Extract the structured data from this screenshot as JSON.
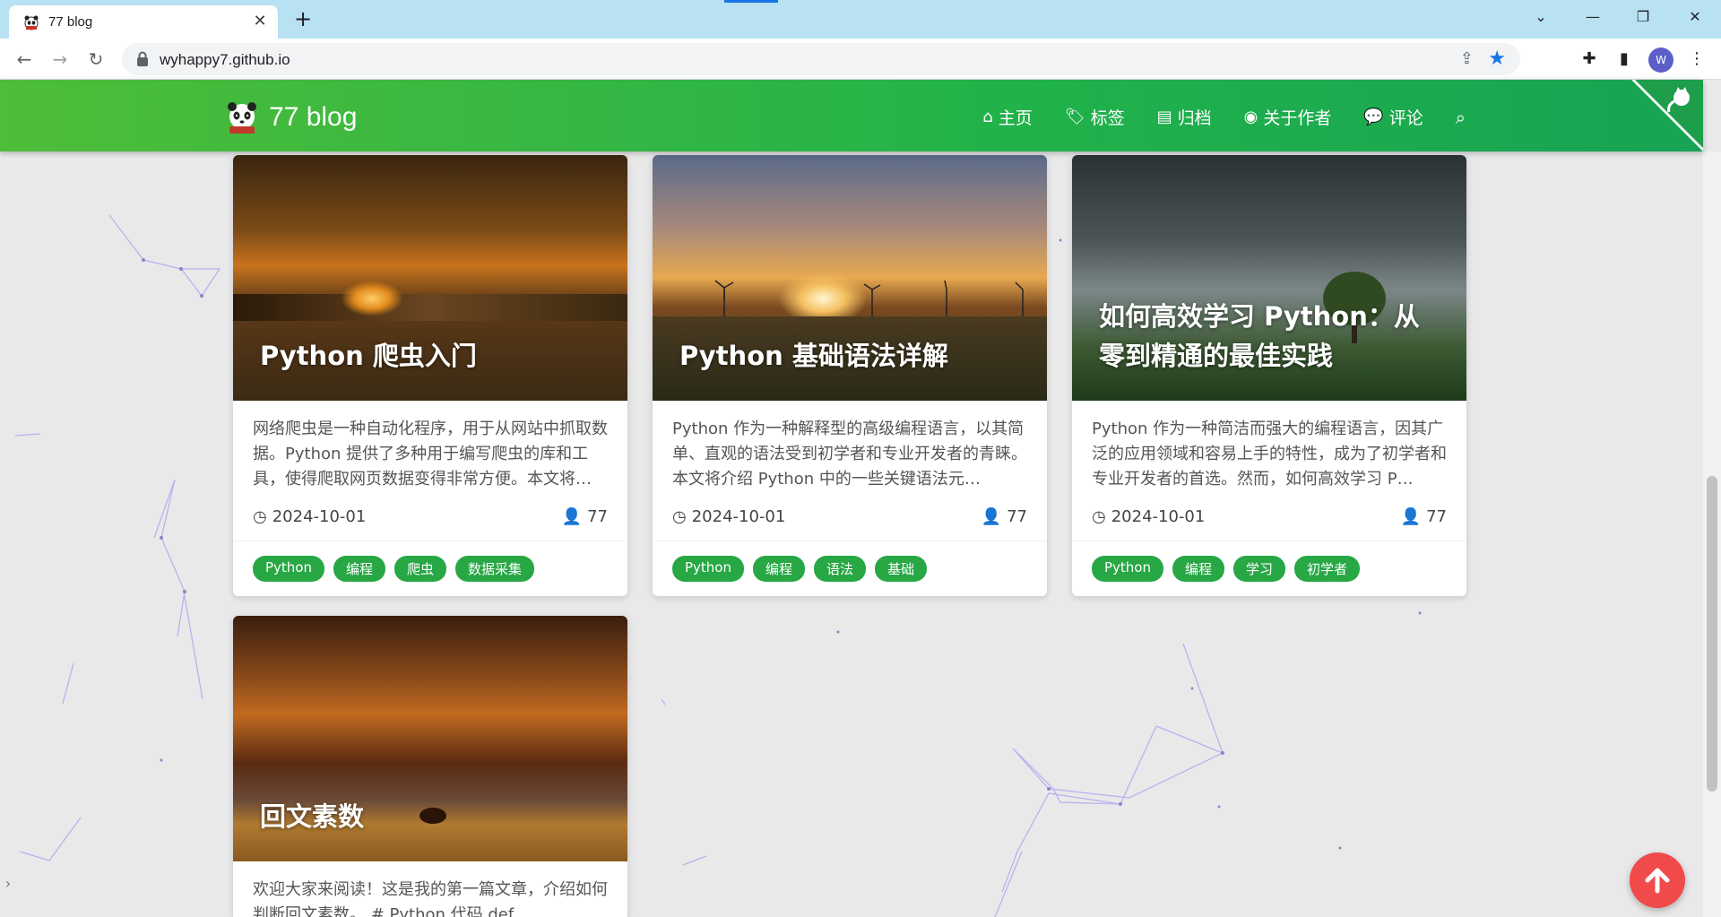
{
  "browser": {
    "tab_title": "77 blog",
    "url": "wyhappy7.github.io",
    "profile_initial": "W",
    "icons": [
      "back-icon",
      "forward-icon",
      "reload-icon",
      "lock-icon",
      "share-icon",
      "star-icon",
      "extensions-icon",
      "side-panel-icon",
      "menu-icon"
    ]
  },
  "header": {
    "brand": "77 blog",
    "menu": [
      {
        "icon": "home-icon",
        "label": "主页"
      },
      {
        "icon": "tags-icon",
        "label": "标签"
      },
      {
        "icon": "archive-icon",
        "label": "归档"
      },
      {
        "icon": "user-circle-icon",
        "label": "关于作者"
      },
      {
        "icon": "comments-icon",
        "label": "评论"
      }
    ]
  },
  "posts": [
    {
      "title": "Python 爬虫入门",
      "excerpt": "网络爬虫是一种自动化程序，用于从网站中抓取数据。Python 提供了多种用于编写爬虫的库和工具，使得爬取网页数据变得非常方便。本文将…",
      "date": "2024-10-01",
      "author": "77",
      "tags": [
        "Python",
        "编程",
        "爬虫",
        "数据采集"
      ]
    },
    {
      "title": "Python 基础语法详解",
      "excerpt": "Python 作为一种解释型的高级编程语言，以其简单、直观的语法受到初学者和专业开发者的青睐。本文将介绍 Python 中的一些关键语法元…",
      "date": "2024-10-01",
      "author": "77",
      "tags": [
        "Python",
        "编程",
        "语法",
        "基础"
      ]
    },
    {
      "title": "如何高效学习 Python：从零到精通的最佳实践",
      "excerpt": "Python 作为一种简洁而强大的编程语言，因其广泛的应用领域和容易上手的特性，成为了初学者和专业开发者的首选。然而，如何高效学习 P…",
      "date": "2024-10-01",
      "author": "77",
      "tags": [
        "Python",
        "编程",
        "学习",
        "初学者"
      ]
    },
    {
      "title": "回文素数",
      "excerpt": "欢迎大家来阅读！这是我的第一篇文章，介绍如何判断回文素数。 # Python 代码 def isPrime(nu…",
      "date": "",
      "author": "",
      "tags": []
    }
  ],
  "colors": {
    "header": "#21b24a",
    "tag": "#28a745",
    "to_top": "#f14a4a",
    "accent": "#1a73e8"
  }
}
